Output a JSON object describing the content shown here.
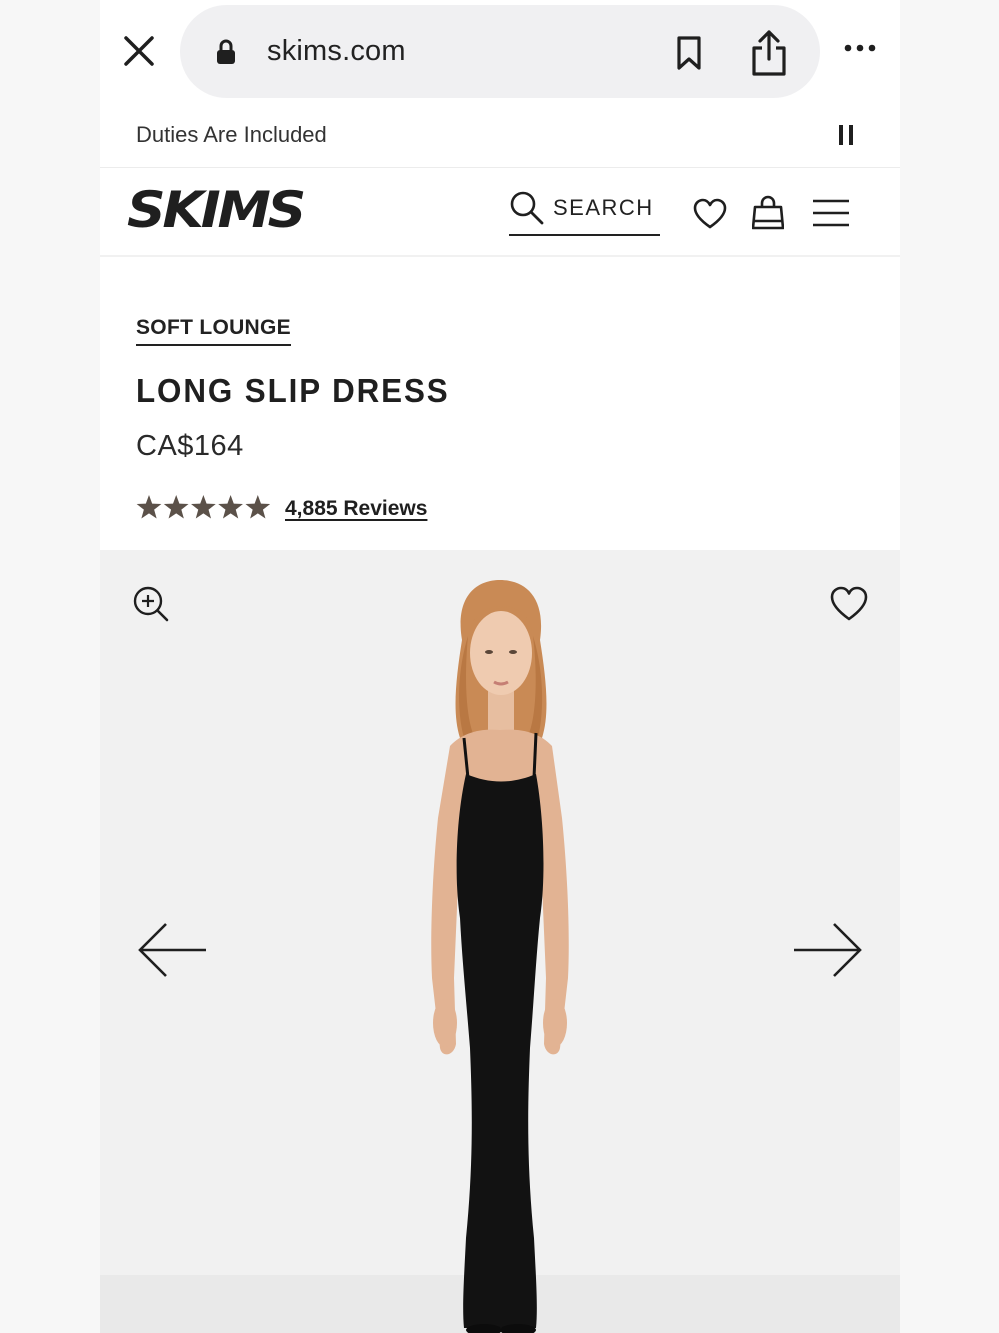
{
  "browser": {
    "url": "skims.com",
    "icons": [
      "close-icon",
      "lock-icon",
      "bookmark-icon",
      "share-icon",
      "more-icon"
    ]
  },
  "announcement": {
    "text": "Duties Are Included",
    "control_icon": "pause-icon"
  },
  "header": {
    "logo": "SKIMS",
    "search_label": "SEARCH",
    "icons": [
      "search-icon",
      "heart-icon",
      "shopping-bag-icon",
      "hamburger-menu-icon"
    ]
  },
  "product": {
    "collection": "SOFT LOUNGE",
    "title": "LONG SLIP DRESS",
    "price": "CA$164",
    "rating": 5,
    "rating_max": 5,
    "reviews_label": "4,885 Reviews"
  },
  "gallery": {
    "icons": [
      "zoom-in-icon",
      "heart-icon",
      "arrow-left-icon",
      "arrow-right-icon"
    ],
    "image_subject": "model-in-black-long-slip-dress"
  },
  "colors": {
    "text": "#1f1f1f",
    "star": "#5b5149",
    "url_pill": "#f0f0f2",
    "gallery_bg": "#f1f1f1"
  }
}
